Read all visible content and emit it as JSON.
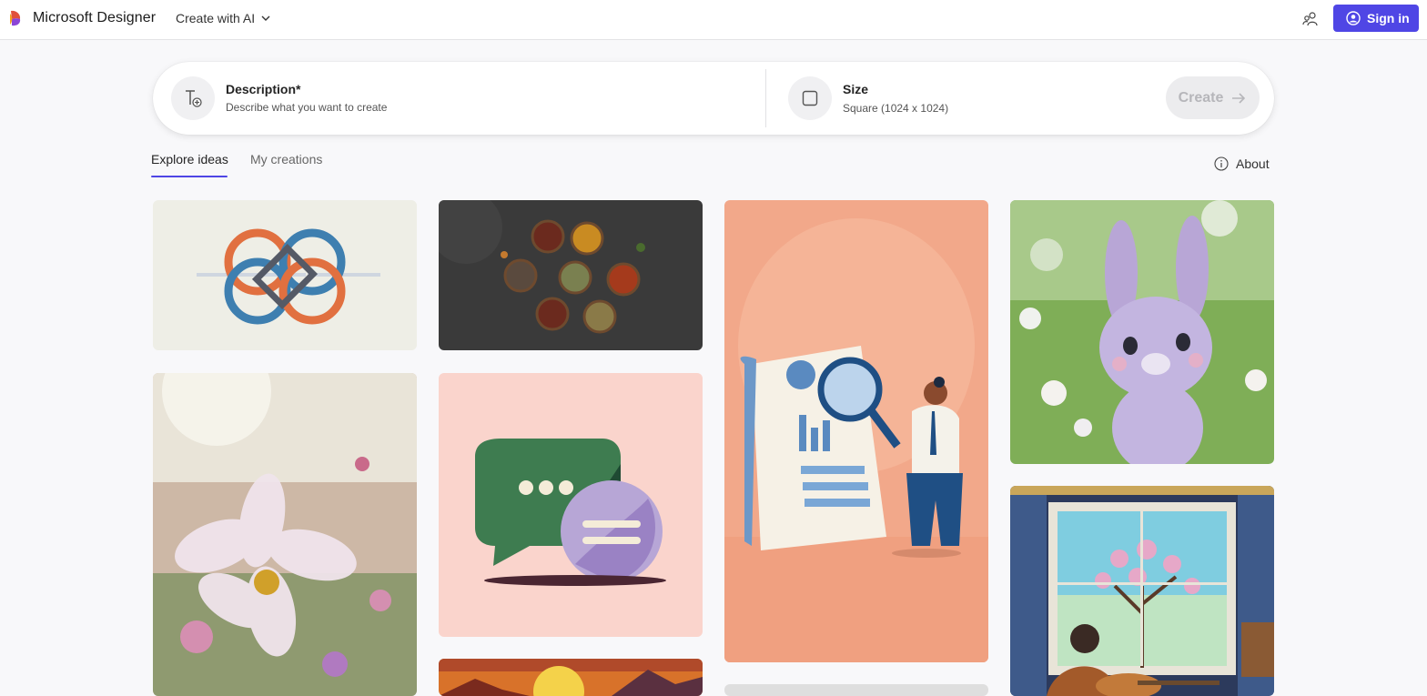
{
  "topbar": {
    "app_title": "Microsoft Designer",
    "create_menu_label": "Create with AI",
    "signin_label": "Sign in",
    "colors": {
      "brand": "#4f46e5"
    }
  },
  "prompt": {
    "description_label": "Description*",
    "description_placeholder": "Describe what you want to create",
    "size_label": "Size",
    "size_value": "Square (1024 x 1024)",
    "create_label": "Create"
  },
  "tabs": {
    "explore": "Explore ideas",
    "creations": "My creations",
    "active": "Explore ideas"
  },
  "about_label": "About",
  "icons": [
    "designer-logo-icon",
    "chevron-down-icon",
    "people-icon",
    "account-icon",
    "text-add-icon",
    "square-icon",
    "arrow-right-icon",
    "info-icon"
  ]
}
